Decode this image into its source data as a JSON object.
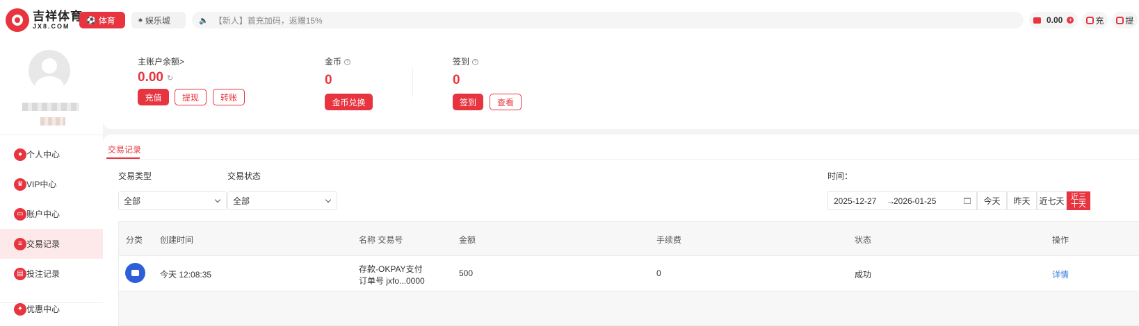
{
  "header": {
    "logo_cn": "吉祥体育",
    "logo_en": "JX8.COM",
    "nav": [
      {
        "label": "体育",
        "icon": "soccer-ball-icon"
      },
      {
        "label": "娱乐城",
        "icon": "spade-icon"
      }
    ],
    "announcement": "【新人】首充加码，返赠15%",
    "balance": "0.00",
    "deposit_label": "充",
    "withdraw_label": "提"
  },
  "sidebar": {
    "items": [
      {
        "label": "个人中心",
        "icon": "user-icon"
      },
      {
        "label": "VIP中心",
        "icon": "crown-icon"
      },
      {
        "label": "账户中心",
        "icon": "wallet-icon"
      },
      {
        "label": "交易记录",
        "icon": "record-icon",
        "active": true
      },
      {
        "label": "投注记录",
        "icon": "bet-icon"
      },
      {
        "label": "优惠中心",
        "icon": "gift-icon"
      }
    ]
  },
  "summary": {
    "main_balance_label": "主账户余额>",
    "main_balance_value": "0.00",
    "recharge_label": "充值",
    "withdraw_label": "提现",
    "transfer_label": "转账",
    "coins_label": "金币",
    "coins_value": "0",
    "coins_exchange_label": "金币兑换",
    "checkin_label": "签到",
    "checkin_value": "0",
    "checkin_button": "签到",
    "view_button": "查看"
  },
  "records": {
    "tab_label": "交易记录",
    "type_filter_label": "交易类型",
    "type_filter_value": "全部",
    "status_filter_label": "交易状态",
    "status_filter_value": "全部",
    "time_label": "时间：",
    "date_start": "2025-12-27",
    "date_arrow": "→",
    "date_end": "2026-01-25",
    "quick": [
      "今天",
      "昨天",
      "近七天",
      "近三十天"
    ],
    "columns": [
      "分类",
      "创建时间",
      "名称 交易号",
      "金额",
      "手续费",
      "状态",
      "操作"
    ],
    "rows": [
      {
        "icon": "deposit-icon",
        "created": "今天 12:08:35",
        "name": "存款-OKPAY支付",
        "order": "订单号 jxfo...0000",
        "amount": "500",
        "fee": "0",
        "status": "成功",
        "action": "详情"
      }
    ]
  },
  "colors": {
    "accent": "#e7343f",
    "deposit_icon_bg": "#2f5fd8",
    "link": "#3d7fd8"
  }
}
